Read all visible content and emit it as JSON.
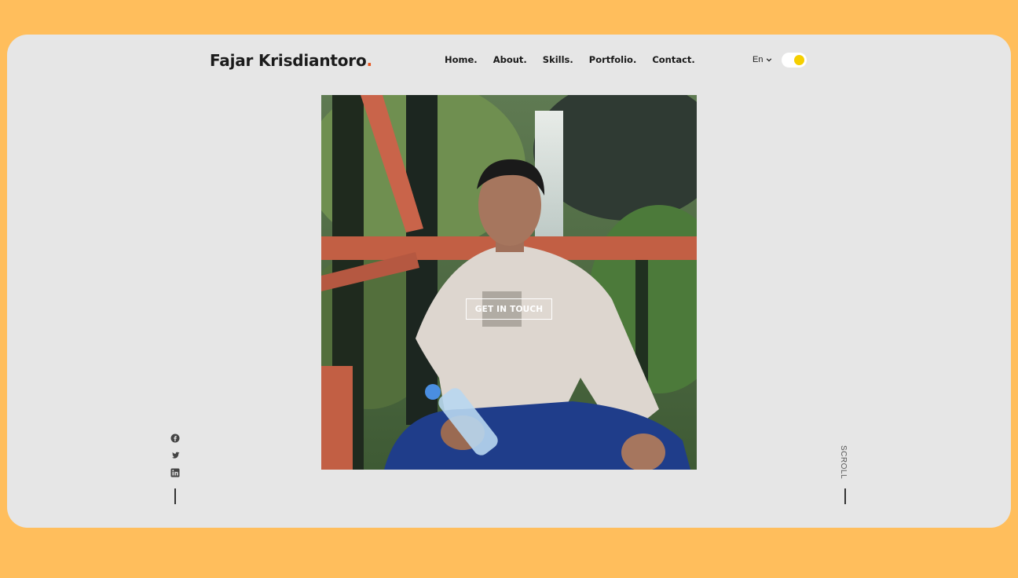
{
  "brand": {
    "name": "Fajar Krisdiantoro",
    "dot": ".",
    "dot_color": "#E8541C"
  },
  "nav": {
    "items": [
      {
        "label": "Home."
      },
      {
        "label": "About."
      },
      {
        "label": "Skills."
      },
      {
        "label": "Portfolio."
      },
      {
        "label": "Contact."
      }
    ]
  },
  "language": {
    "selected": "En"
  },
  "theme_toggle": {
    "knob_color": "#F5CF00"
  },
  "hero": {
    "cta_label": "GET IN TOUCH"
  },
  "social": {
    "icons": [
      "facebook-icon",
      "twitter-icon",
      "linkedin-icon"
    ]
  },
  "scroll": {
    "label": "SCROLL"
  },
  "colors": {
    "page_bg": "#FFBE5C",
    "frame_bg": "#E6E6E6",
    "text": "#1a1a1a"
  }
}
